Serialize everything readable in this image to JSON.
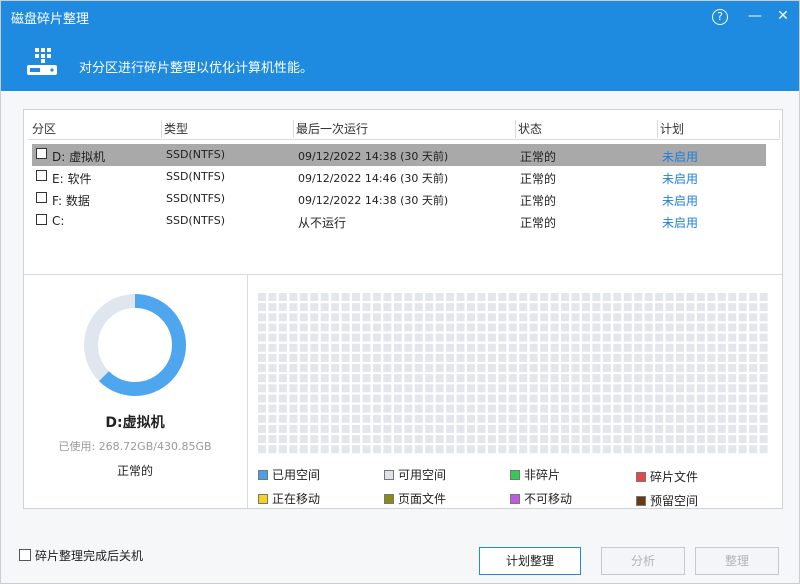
{
  "window": {
    "title": "磁盘碎片整理",
    "help_glyph": "?",
    "minimize_glyph": "—",
    "close_glyph": "✕"
  },
  "banner": {
    "description": "对分区进行碎片整理以优化计算机性能。",
    "icon": "drive-icon"
  },
  "table": {
    "headers": [
      "分区",
      "类型",
      "最后一次运行",
      "状态",
      "计划"
    ],
    "rows": [
      {
        "partition": "D:  虚拟机",
        "type": "SSD(NTFS)",
        "last_run": "09/12/2022 14:38 (30 天前)",
        "status": "正常的",
        "plan": "未启用",
        "selected": true
      },
      {
        "partition": "E:  软件",
        "type": "SSD(NTFS)",
        "last_run": "09/12/2022 14:46 (30 天前)",
        "status": "正常的",
        "plan": "未启用",
        "selected": false
      },
      {
        "partition": "F:  数据",
        "type": "SSD(NTFS)",
        "last_run": "09/12/2022 14:38 (30 天前)",
        "status": "正常的",
        "plan": "未启用",
        "selected": false
      },
      {
        "partition": "C:",
        "type": "SSD(NTFS)",
        "last_run": "从不运行",
        "status": "正常的",
        "plan": "未启用",
        "selected": false
      }
    ]
  },
  "drive": {
    "name": "D:虚拟机",
    "usage_text": "已使用: 268.72GB/430.85GB",
    "used_fraction": 0.6237,
    "status": "正常的",
    "used_color": "#4ea6ef",
    "free_color": "#dfe6ee"
  },
  "map": {
    "cell_color": "#e3e7ec"
  },
  "legend": [
    {
      "label": "已用空间",
      "color": "#4a9fe8"
    },
    {
      "label": "可用空间",
      "color": "#dfe3e8"
    },
    {
      "label": "非碎片",
      "color": "#2fcc4f"
    },
    {
      "label": "碎片文件",
      "color": "#e84545"
    },
    {
      "label": "正在移动",
      "color": "#f2d321"
    },
    {
      "label": "页面文件",
      "color": "#8a8a1a"
    },
    {
      "label": "不可移动",
      "color": "#c05ae0"
    },
    {
      "label": "预留空间",
      "color": "#6b3a12"
    }
  ],
  "footer": {
    "shutdown_label": "碎片整理完成后关机",
    "schedule_button": "计划整理",
    "analyze_button": "分析",
    "defrag_button": "整理"
  }
}
